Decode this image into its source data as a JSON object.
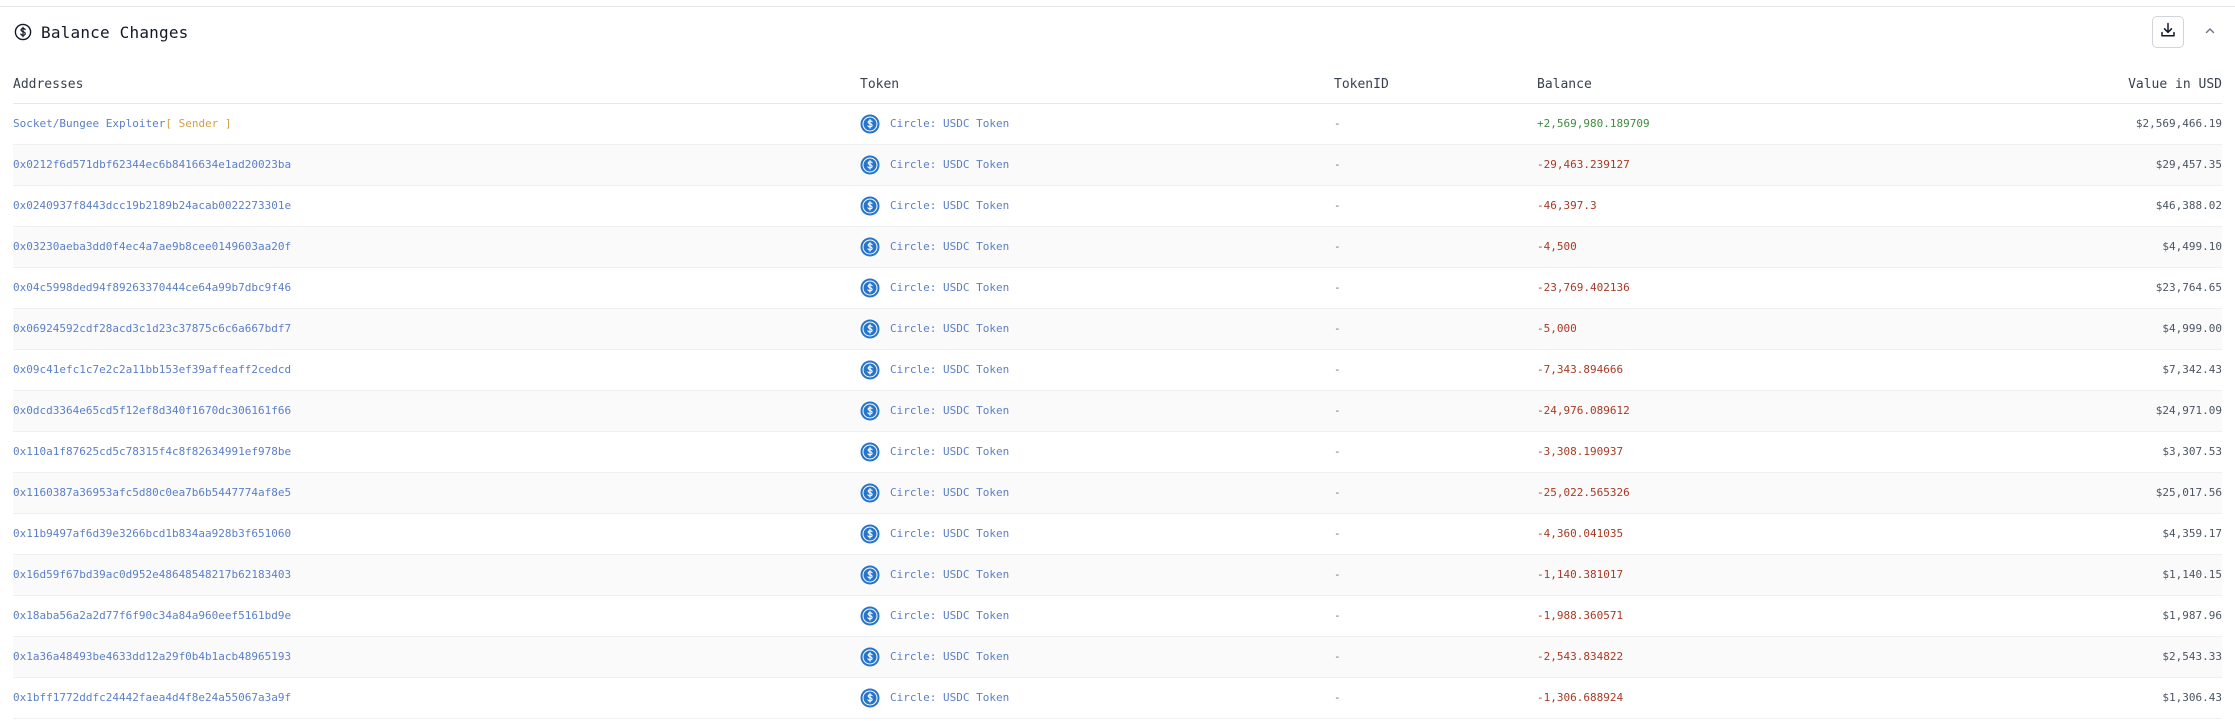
{
  "panel": {
    "title": "Balance Changes",
    "title_icon": "dollar-circle-icon",
    "download_icon": "download-icon",
    "collapse_icon": "chevron-up-icon"
  },
  "table": {
    "headers": {
      "addresses": "Addresses",
      "token": "Token",
      "tokenid": "TokenID",
      "balance": "Balance",
      "value_usd": "Value in USD"
    },
    "rows": [
      {
        "address": "Socket/Bungee Exploiter",
        "tag": "[ Sender ]",
        "token": "Circle: USDC Token",
        "tokenid": "-",
        "balance": "+2,569,980.189709",
        "sign": "pos",
        "usd": "$2,569,466.19"
      },
      {
        "address": "0x0212f6d571dbf62344ec6b8416634e1ad20023ba",
        "tag": "",
        "token": "Circle: USDC Token",
        "tokenid": "-",
        "balance": "-29,463.239127",
        "sign": "neg",
        "usd": "$29,457.35"
      },
      {
        "address": "0x0240937f8443dcc19b2189b24acab0022273301e",
        "tag": "",
        "token": "Circle: USDC Token",
        "tokenid": "-",
        "balance": "-46,397.3",
        "sign": "neg",
        "usd": "$46,388.02"
      },
      {
        "address": "0x03230aeba3dd0f4ec4a7ae9b8cee0149603aa20f",
        "tag": "",
        "token": "Circle: USDC Token",
        "tokenid": "-",
        "balance": "-4,500",
        "sign": "neg",
        "usd": "$4,499.10"
      },
      {
        "address": "0x04c5998ded94f89263370444ce64a99b7dbc9f46",
        "tag": "",
        "token": "Circle: USDC Token",
        "tokenid": "-",
        "balance": "-23,769.402136",
        "sign": "neg",
        "usd": "$23,764.65"
      },
      {
        "address": "0x06924592cdf28acd3c1d23c37875c6c6a667bdf7",
        "tag": "",
        "token": "Circle: USDC Token",
        "tokenid": "-",
        "balance": "-5,000",
        "sign": "neg",
        "usd": "$4,999.00"
      },
      {
        "address": "0x09c41efc1c7e2c2a11bb153ef39affeaff2cedcd",
        "tag": "",
        "token": "Circle: USDC Token",
        "tokenid": "-",
        "balance": "-7,343.894666",
        "sign": "neg",
        "usd": "$7,342.43"
      },
      {
        "address": "0x0dcd3364e65cd5f12ef8d340f1670dc306161f66",
        "tag": "",
        "token": "Circle: USDC Token",
        "tokenid": "-",
        "balance": "-24,976.089612",
        "sign": "neg",
        "usd": "$24,971.09"
      },
      {
        "address": "0x110a1f87625cd5c78315f4c8f82634991ef978be",
        "tag": "",
        "token": "Circle: USDC Token",
        "tokenid": "-",
        "balance": "-3,308.190937",
        "sign": "neg",
        "usd": "$3,307.53"
      },
      {
        "address": "0x1160387a36953afc5d80c0ea7b6b5447774af8e5",
        "tag": "",
        "token": "Circle: USDC Token",
        "tokenid": "-",
        "balance": "-25,022.565326",
        "sign": "neg",
        "usd": "$25,017.56"
      },
      {
        "address": "0x11b9497af6d39e3266bcd1b834aa928b3f651060",
        "tag": "",
        "token": "Circle: USDC Token",
        "tokenid": "-",
        "balance": "-4,360.041035",
        "sign": "neg",
        "usd": "$4,359.17"
      },
      {
        "address": "0x16d59f67bd39ac0d952e48648548217b62183403",
        "tag": "",
        "token": "Circle: USDC Token",
        "tokenid": "-",
        "balance": "-1,140.381017",
        "sign": "neg",
        "usd": "$1,140.15"
      },
      {
        "address": "0x18aba56a2a2d77f6f90c34a84a960eef5161bd9e",
        "tag": "",
        "token": "Circle: USDC Token",
        "tokenid": "-",
        "balance": "-1,988.360571",
        "sign": "neg",
        "usd": "$1,987.96"
      },
      {
        "address": "0x1a36a48493be4633dd12a29f0b4b1acb48965193",
        "tag": "",
        "token": "Circle: USDC Token",
        "tokenid": "-",
        "balance": "-2,543.834822",
        "sign": "neg",
        "usd": "$2,543.33"
      },
      {
        "address": "0x1bff1772ddfc24442faea4d4f8e24a55067a3a9f",
        "tag": "",
        "token": "Circle: USDC Token",
        "tokenid": "-",
        "balance": "-1,306.688924",
        "sign": "neg",
        "usd": "$1,306.43"
      }
    ]
  },
  "colors": {
    "link": "#5b7fc7",
    "sender_tag": "#d4a042",
    "positive": "#3f8a3f",
    "negative": "#a83a24",
    "usdc_icon": "#2775ca"
  }
}
